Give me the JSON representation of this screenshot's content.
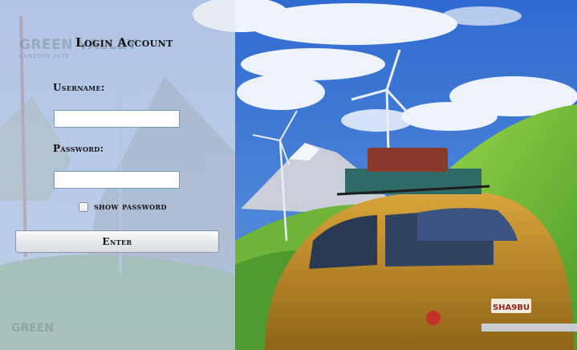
{
  "login": {
    "title": "Login Account",
    "username_label": "Username:",
    "username_value": "",
    "password_label": "Password:",
    "password_value": "",
    "show_password_label": "show password",
    "show_password_checked": false,
    "enter_label": "Enter"
  },
  "watermark": {
    "title": "GREEN VALLEY",
    "subtitle": "CANZONE 2019",
    "bottom": "GREEN"
  },
  "scene": {
    "license_plate": "SHA9BU",
    "colors": {
      "sky": "#3a6fc4",
      "cloud": "#eef3fb",
      "hill_green": "#7cc63c",
      "car_yellow": "#c8962a",
      "panel_overlay": "#e4e8ee"
    }
  }
}
